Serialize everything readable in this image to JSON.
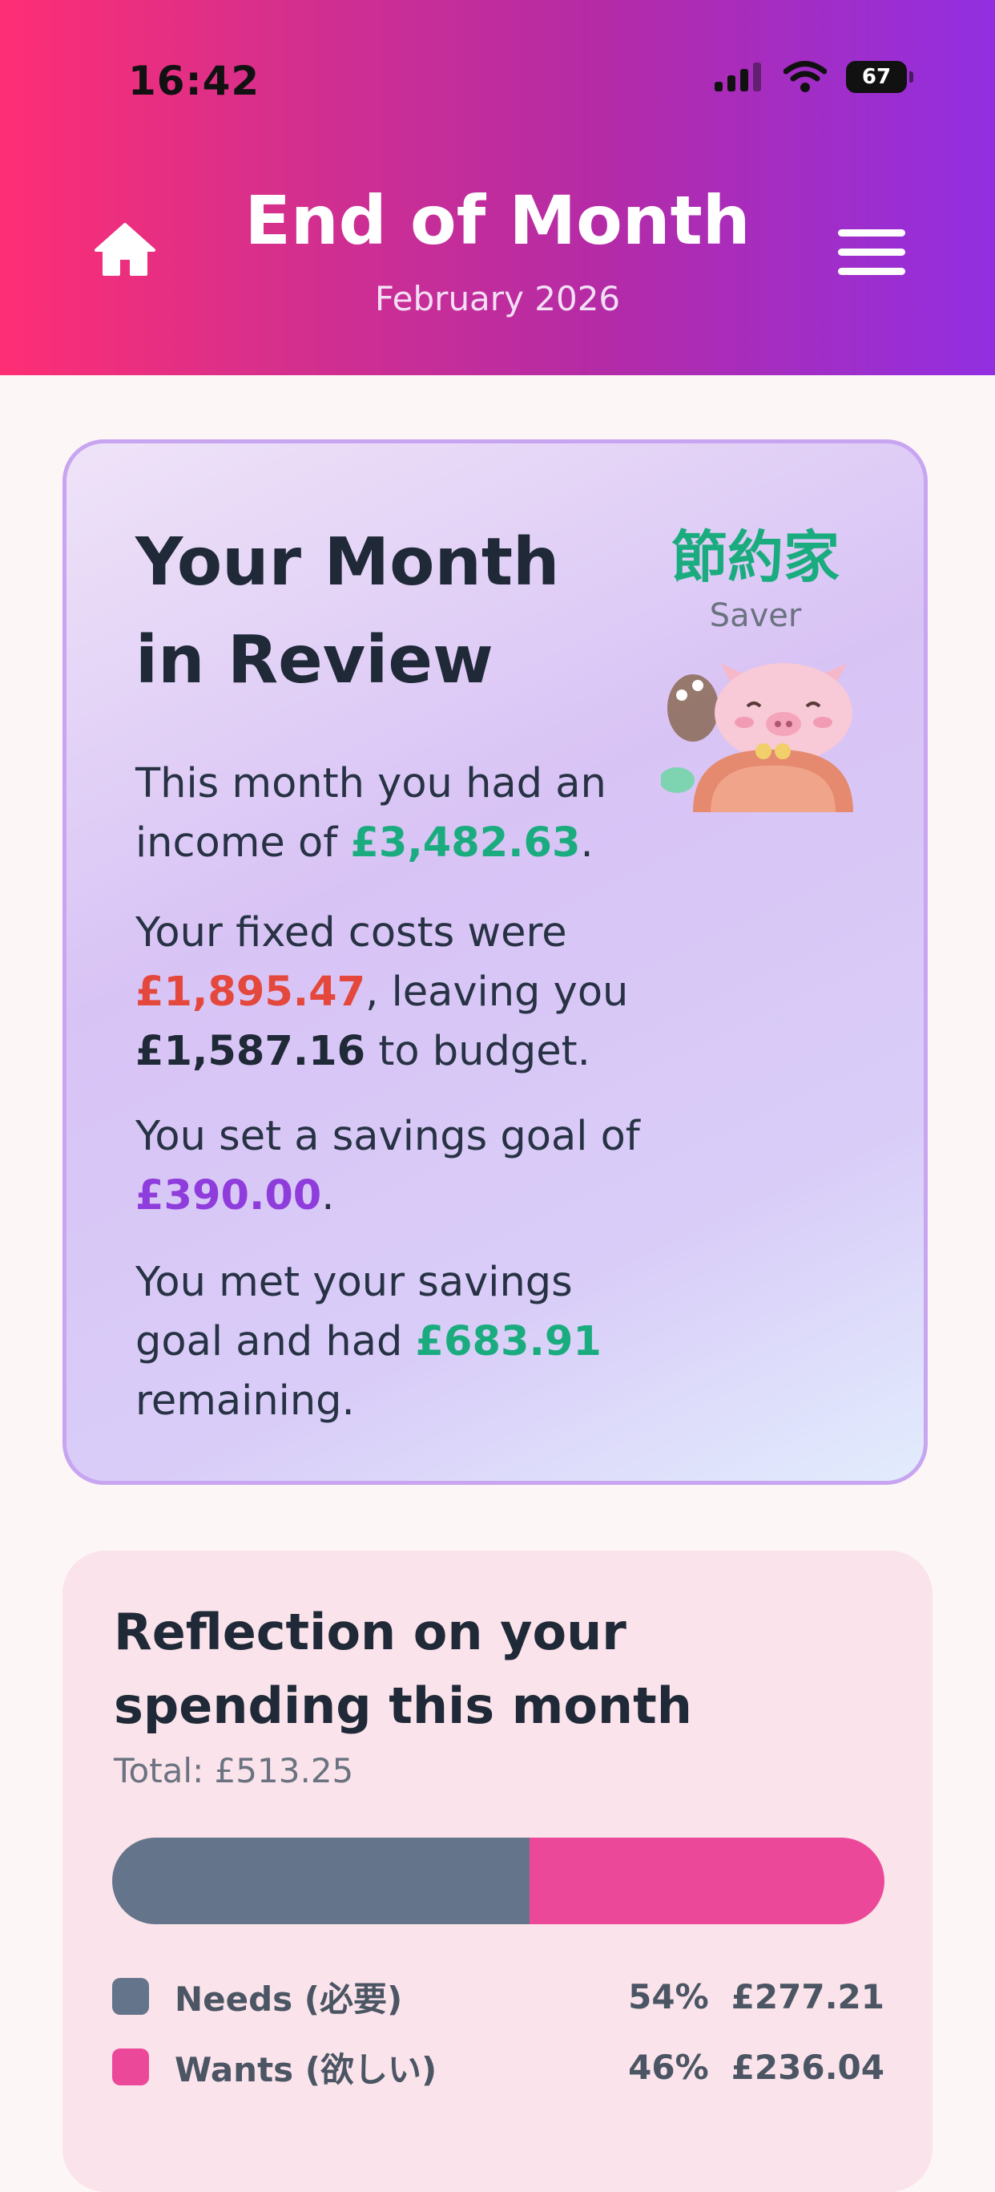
{
  "status_bar": {
    "time": "16:42",
    "battery": "67"
  },
  "header": {
    "title": "End of Month",
    "subtitle": "February 2026"
  },
  "review": {
    "title": "Your Month in Review",
    "badge_kanji": "節約家",
    "badge_label": "Saver",
    "income_prefix": "This month you had an income of ",
    "income_amount": "£3,482.63",
    "income_suffix": ".",
    "fixed_prefix": "Your fixed costs were ",
    "fixed_amount": "£1,895.47",
    "fixed_middle": ", leaving you ",
    "budget_amount": "£1,587.16",
    "fixed_suffix": " to budget.",
    "goal_prefix": "You set a savings goal of ",
    "goal_amount": "£390.00",
    "goal_suffix": ".",
    "met_prefix": "You met your savings goal and had ",
    "met_amount": "£683.91",
    "met_suffix": " remaining."
  },
  "reflection": {
    "title": "Reflection on your spending this month",
    "total": "Total: £513.25",
    "items": [
      {
        "label": "Needs (必要)",
        "percent": "54%",
        "amount": "£277.21",
        "fraction": 0.54,
        "color": "#64748b"
      },
      {
        "label": "Wants (欲しい)",
        "percent": "46%",
        "amount": "£236.04",
        "fraction": 0.46,
        "color": "#ec4899"
      }
    ]
  },
  "colors": {
    "income": "#1aac7f",
    "fixed_costs": "#e4473c",
    "savings_goal": "#8f3cdc",
    "header_gradient_start": "#fe2e74",
    "header_gradient_end": "#922fe1"
  },
  "icons": {
    "home": "home-icon",
    "menu": "hamburger-menu-icon"
  }
}
